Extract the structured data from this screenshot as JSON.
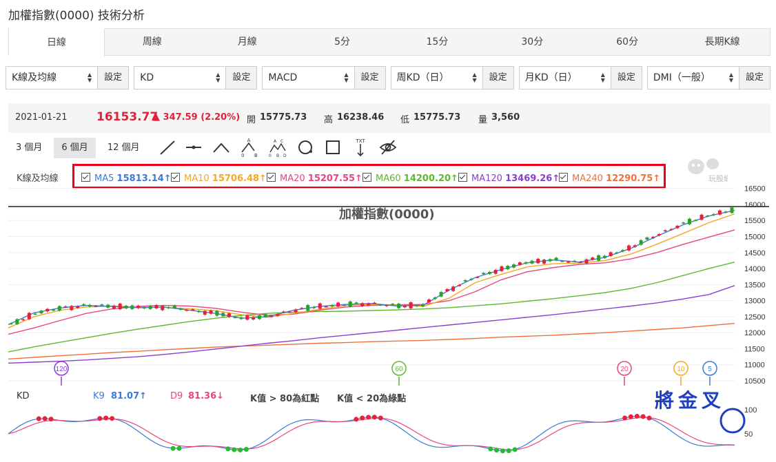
{
  "title": "加權指數(0000) 技術分析",
  "tabs": [
    "日線",
    "周線",
    "月線",
    "5分",
    "15分",
    "30分",
    "60分",
    "長期K線"
  ],
  "selectors": [
    {
      "value": "K線及均線",
      "button": "設定"
    },
    {
      "value": "KD",
      "button": "設定"
    },
    {
      "value": "MACD",
      "button": "設定"
    },
    {
      "value": "周KD（日）",
      "button": "設定"
    },
    {
      "value": "月KD（日）",
      "button": "設定"
    },
    {
      "value": "DMI（一般）",
      "button": "設定"
    }
  ],
  "info": {
    "date": "2021-01-21",
    "price": "16153.77",
    "change": "▲ 347.59 (2.20%)",
    "open_label": "開",
    "open": "15775.73",
    "high_label": "高",
    "high": "16238.46",
    "low_label": "低",
    "low": "15775.73",
    "vol_label": "量",
    "vol": "3,560"
  },
  "ranges": [
    "3 個月",
    "6 個月",
    "12 個月"
  ],
  "tools": [
    "line-tool-icon",
    "horizontal-line-tool-icon",
    "angle-tool-icon",
    "wave-ab-tool-icon",
    "wave-abcd-tool-icon",
    "circle-tool-icon",
    "rectangle-tool-icon",
    "text-tool-icon",
    "hide-tool-icon"
  ],
  "tool_text": {
    "a": "A",
    "b": "B",
    "c": "C",
    "d": "D",
    "zero": "0",
    "txt": "TXT"
  },
  "ma": {
    "label": "K線及均線",
    "items": [
      {
        "name": "MA5",
        "value": "15813.14↑",
        "color": "#3a7bd5"
      },
      {
        "name": "MA10",
        "value": "15706.48↑",
        "color": "#f5a623"
      },
      {
        "name": "MA20",
        "value": "15207.55↑",
        "color": "#e8467c"
      },
      {
        "name": "MA60",
        "value": "14200.20↑",
        "color": "#5cb82c"
      },
      {
        "name": "MA120",
        "value": "13469.26↑",
        "color": "#8a3fd1"
      },
      {
        "name": "MA240",
        "value": "12290.75↑",
        "color": "#f0703a"
      }
    ]
  },
  "logo_text": "玩股網",
  "chart_label": "加權指數(0000)",
  "kd": {
    "label": "KD",
    "k_label": "K9",
    "k_value": "81.07↑",
    "d_label": "D9",
    "d_value": "81.36↓",
    "rule_red": "K值 > 80為紅點",
    "rule_green": "K值 < 20為綠點",
    "ticks": [
      "100",
      "50"
    ]
  },
  "annotation": "將金叉",
  "chart_data": {
    "type": "candlestick",
    "title": "加權指數(0000)",
    "y_ticks": [
      16500,
      16000,
      15500,
      15000,
      14500,
      14000,
      13500,
      13000,
      12500,
      12000,
      11500,
      11000,
      10500
    ],
    "ylim": [
      10350,
      16600
    ],
    "ma_markers": [
      {
        "label": "120",
        "color": "#8a3fd1"
      },
      {
        "label": "60",
        "color": "#5cb82c"
      },
      {
        "label": "20",
        "color": "#e8467c"
      },
      {
        "label": "10",
        "color": "#f5a623"
      },
      {
        "label": "5",
        "color": "#3a7bd5"
      }
    ],
    "series": [
      {
        "name": "MA240",
        "color": "#f0703a",
        "values": [
          11180,
          11230,
          11280,
          11330,
          11380,
          11420,
          11470,
          11510,
          11550,
          11580,
          11610,
          11640,
          11670,
          11690,
          11720,
          11740,
          11760,
          11790,
          11820,
          11860,
          11890,
          11920,
          11960,
          12000,
          12050,
          12100,
          12150,
          12220,
          12290
        ]
      },
      {
        "name": "MA120",
        "color": "#8a3fd1",
        "values": [
          11050,
          11080,
          11110,
          11150,
          11200,
          11250,
          11320,
          11400,
          11490,
          11580,
          11670,
          11750,
          11840,
          11920,
          12000,
          12080,
          12160,
          12240,
          12320,
          12400,
          12480,
          12560,
          12650,
          12740,
          12830,
          12930,
          13050,
          13190,
          13469
        ]
      },
      {
        "name": "MA60",
        "color": "#5cb82c",
        "values": [
          11400,
          11560,
          11700,
          11840,
          11980,
          12110,
          12230,
          12350,
          12450,
          12540,
          12600,
          12640,
          12660,
          12670,
          12690,
          12710,
          12740,
          12780,
          12840,
          12900,
          12980,
          13060,
          13150,
          13250,
          13380,
          13560,
          13780,
          14000,
          14200
        ]
      },
      {
        "name": "MA20",
        "color": "#e8467c",
        "values": [
          11950,
          12150,
          12380,
          12600,
          12740,
          12820,
          12850,
          12830,
          12760,
          12640,
          12540,
          12580,
          12700,
          12800,
          12850,
          12870,
          12880,
          13000,
          13280,
          13650,
          13900,
          14030,
          14130,
          14180,
          14300,
          14500,
          14750,
          14980,
          15207
        ]
      },
      {
        "name": "MA10",
        "color": "#f5a623",
        "values": [
          12150,
          12500,
          12700,
          12800,
          12830,
          12800,
          12790,
          12750,
          12680,
          12560,
          12480,
          12600,
          12730,
          12850,
          12880,
          12860,
          12820,
          13080,
          13560,
          13820,
          14050,
          14150,
          14170,
          14250,
          14450,
          14760,
          15090,
          15430,
          15706
        ]
      },
      {
        "name": "MA5",
        "color": "#3a7bd5",
        "values": [
          12250,
          12620,
          12770,
          12850,
          12820,
          12780,
          12800,
          12700,
          12600,
          12450,
          12500,
          12700,
          12820,
          12880,
          12910,
          12830,
          12860,
          13330,
          13720,
          13970,
          14180,
          14270,
          14200,
          14350,
          14630,
          15010,
          15360,
          15640,
          15813
        ]
      }
    ]
  }
}
